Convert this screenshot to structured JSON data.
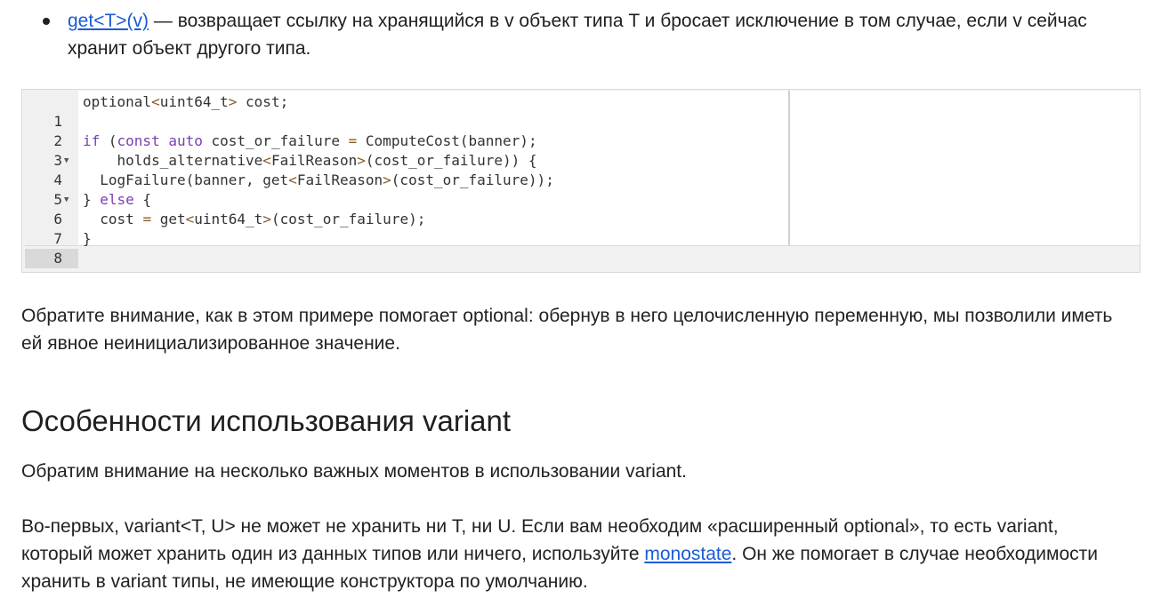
{
  "bullet": {
    "link_text": "get<T>(v)",
    "text": " — возвращает ссылку на хранящийся в v объект типа T и бросает исключение в том случае, если v сейчас хранит объект другого типа."
  },
  "code": {
    "lines": [
      {
        "num": "1",
        "fold": "",
        "text": "optional<uint64_t> cost;"
      },
      {
        "num": "2",
        "fold": "",
        "text": ""
      },
      {
        "num": "3",
        "fold": "",
        "text": "if (const auto cost_or_failure = ComputeCost(banner);"
      },
      {
        "num": "4",
        "fold": "▼",
        "text": "    holds_alternative<FailReason>(cost_or_failure)) {"
      },
      {
        "num": "5",
        "fold": "",
        "text": "  LogFailure(banner, get<FailReason>(cost_or_failure));"
      },
      {
        "num": "6",
        "fold": "▼",
        "text": "} else {"
      },
      {
        "num": "7",
        "fold": "",
        "text": "  cost = get<uint64_t>(cost_or_failure);"
      },
      {
        "num": "8",
        "fold": "",
        "text": "}"
      }
    ]
  },
  "paragraph1": "Обратите внимание, как в этом примере помогает optional: обернув в него целочисленную переменную, мы позволили иметь ей явное неинициализированное значение.",
  "heading": "Особенности использования variant",
  "paragraph2": "Обратим внимание на несколько важных моментов в использовании variant.",
  "paragraph3": {
    "before": "Во-первых, variant<T, U> не может не хранить ни T, ни U. Если вам необходим «расширенный optional», то есть variant, который может хранить один из данных типов или ничего, используйте ",
    "link_text": "monostate",
    "after": ". Он же помогает в случае необходимости хранить в variant типы, не имеющие конструктора по умолчанию."
  }
}
